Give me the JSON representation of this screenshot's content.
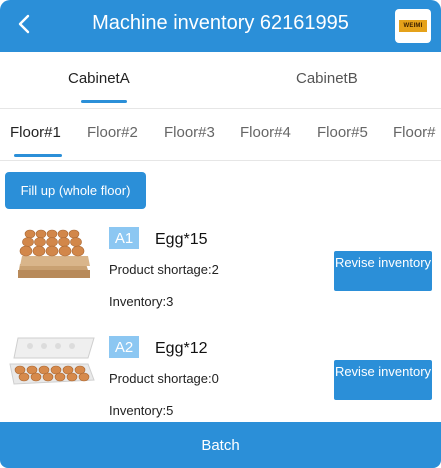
{
  "header": {
    "title": "Machine inventory 62161995",
    "logo_text": "WEIMI"
  },
  "cabinet_tabs": [
    {
      "label": "CabinetA",
      "active": true
    },
    {
      "label": "CabinetB",
      "active": false
    }
  ],
  "floor_tabs": [
    {
      "label": "Floor#1",
      "active": true
    },
    {
      "label": "Floor#2",
      "active": false
    },
    {
      "label": "Floor#3",
      "active": false
    },
    {
      "label": "Floor#4",
      "active": false
    },
    {
      "label": "Floor#5",
      "active": false
    },
    {
      "label": "Floor#",
      "active": false
    }
  ],
  "fill_up_label": "Fill up (whole floor)",
  "items": [
    {
      "code": "A1",
      "name": "Egg*15",
      "shortage": "Product shortage:2",
      "inventory": "Inventory:3",
      "button": "Revise inventory"
    },
    {
      "code": "A2",
      "name": "Egg*12",
      "shortage": "Product shortage:0",
      "inventory": "Inventory:5",
      "button": "Revise inventory"
    }
  ],
  "batch_label": "Batch",
  "colors": {
    "accent": "#2b8fd8",
    "code_badge": "#8cc7f2"
  }
}
